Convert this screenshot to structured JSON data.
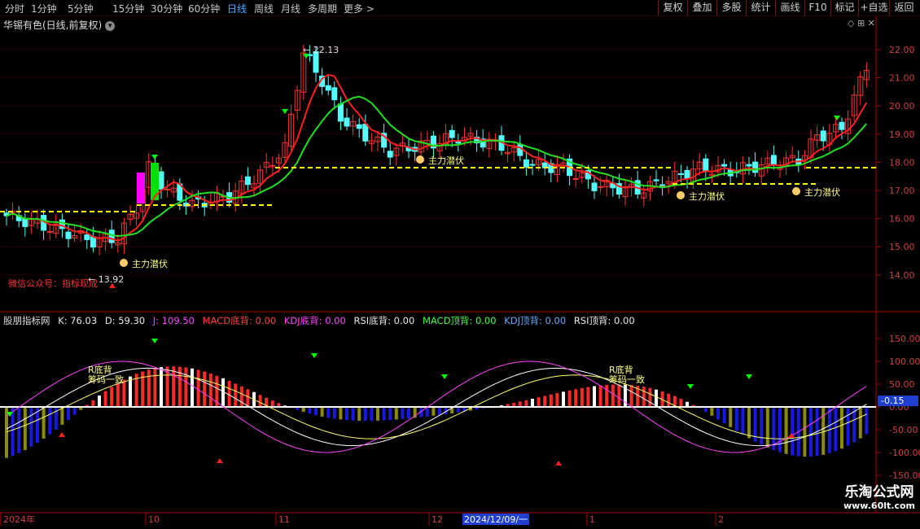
{
  "toolbar": {
    "periods": [
      "分时",
      "1分钟",
      "5分钟",
      "15分钟",
      "30分钟",
      "60分钟",
      "日线",
      "周线",
      "月线",
      "多周期",
      "更多 >"
    ],
    "active_period": "日线",
    "tools": [
      "复权",
      "叠加",
      "多股",
      "统计",
      "画线",
      "F10",
      "标记",
      "+自选",
      "返回"
    ]
  },
  "main_panel": {
    "title": "华锡有色(日线,前复权)",
    "panel_icons": "◇ ⊞ ✕",
    "high_label": "22.13",
    "low_label": "13.92",
    "wechat_note": "微信公众号：指标现成",
    "signal_label": "主力潜伏",
    "signal_count": 4,
    "y_axis": [
      "22.00",
      "21.00",
      "20.00",
      "19.00",
      "18.00",
      "17.00",
      "16.00",
      "15.00",
      "14.00"
    ]
  },
  "indicator_panel": {
    "name": "股朋指标网",
    "legend": [
      {
        "label": "K: 76.03",
        "color": "#e8e8e8"
      },
      {
        "label": "D: 59.30",
        "color": "#e8e8e8"
      },
      {
        "label": "J: 109.50",
        "color": "#ff44ff"
      },
      {
        "label": "MACD底背: 0.00",
        "color": "#ff4444"
      },
      {
        "label": "KDJ底背: 0.00",
        "color": "#ff44ff"
      },
      {
        "label": "RSI底背: 0.00",
        "color": "#e8e8e8"
      },
      {
        "label": "MACD顶背: 0.00",
        "color": "#44ff44"
      },
      {
        "label": "KDJ顶背: 0.00",
        "color": "#6aa8ff"
      },
      {
        "label": "RSI顶背: 0.00",
        "color": "#e8e8e8"
      }
    ],
    "y_axis": [
      "150.00",
      "100.00",
      "50.00",
      "0.00",
      "-50.00",
      "-100.00",
      "-150.00"
    ],
    "current_value": "0.15",
    "bottom_label": "R底背",
    "chip_label": "筹码一致"
  },
  "date_axis": {
    "labels": [
      "2024年",
      "10",
      "11",
      "12",
      "2024/12/09/一",
      "1",
      "2"
    ]
  },
  "watermark": {
    "title": "乐淘公式网",
    "url": "www.60lt.com"
  },
  "colors": {
    "up": "#ff3232",
    "down": "#54ffff",
    "ma_fast": "#ff2020",
    "ma_slow": "#20e020",
    "dashed": "#ffff00",
    "axis": "#b00000"
  }
}
